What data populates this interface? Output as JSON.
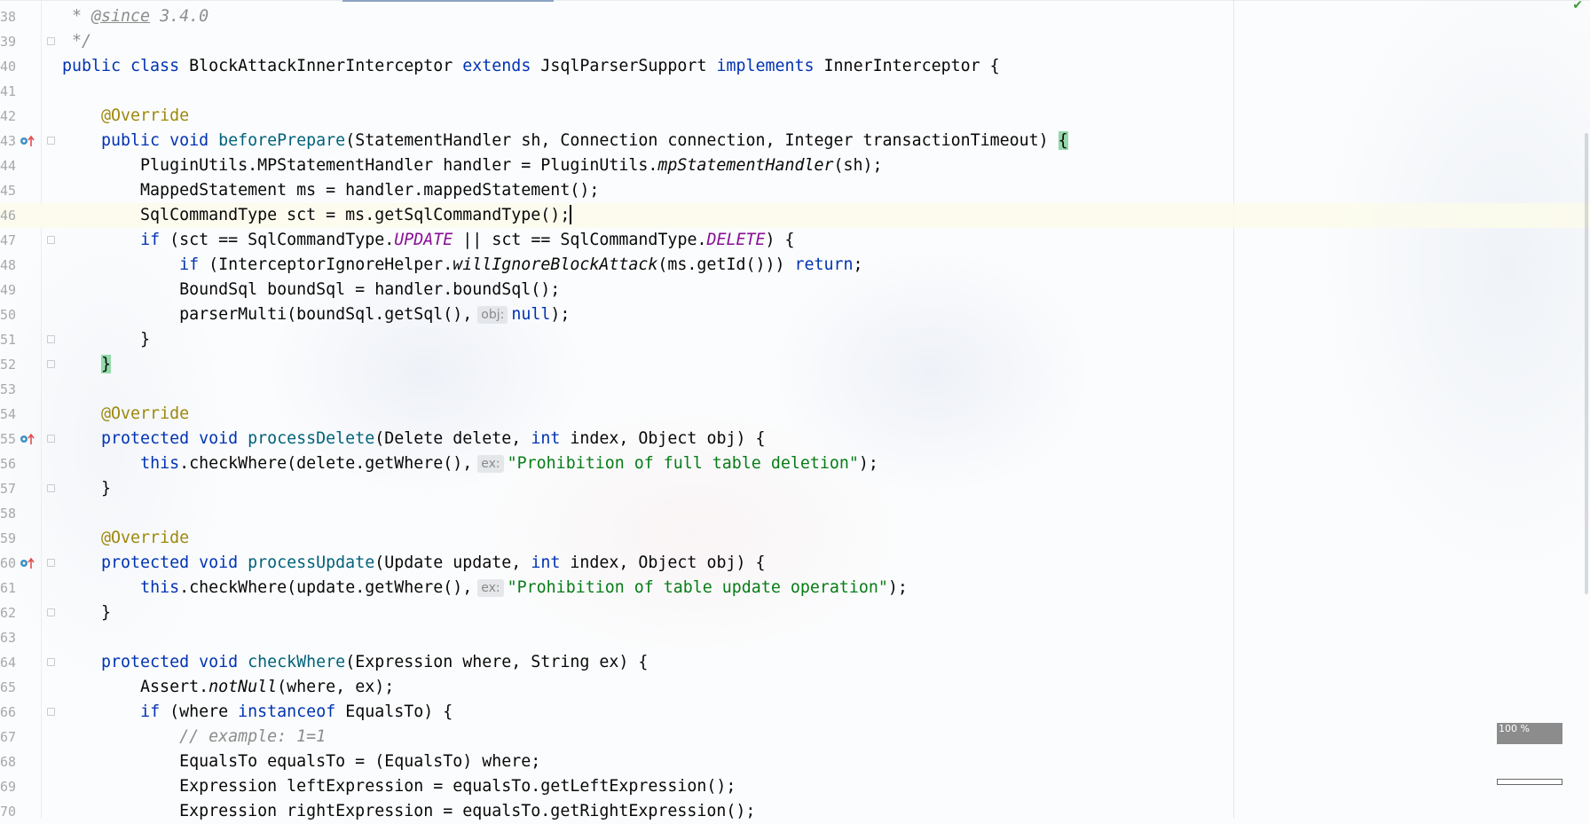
{
  "editor": {
    "first_line": 38,
    "current_line": 46,
    "zoom_label": "100 %",
    "colors": {
      "keyword": "#0033b3",
      "annotation": "#9e880d",
      "method_decl": "#00627a",
      "static_field": "#871094",
      "string": "#067d17",
      "comment": "#8c8c8c",
      "brace_match": "#93d9a9"
    },
    "override_icon_lines": [
      43,
      55,
      60
    ],
    "fold_icon_lines": [
      39,
      43,
      47,
      51,
      52,
      55,
      57,
      60,
      62,
      64,
      66
    ],
    "lines": [
      [
        [
          " * ",
          "c"
        ],
        [
          "@since",
          "ctag"
        ],
        [
          " 3.4.0",
          "c"
        ]
      ],
      [
        [
          " */",
          "c"
        ]
      ],
      [
        [
          "public class ",
          "kw"
        ],
        [
          "BlockAttackInnerInterceptor ",
          ""
        ],
        [
          "extends ",
          "kw"
        ],
        [
          "JsqlParserSupport ",
          ""
        ],
        [
          "implements ",
          "kw"
        ],
        [
          "InnerInterceptor {",
          ""
        ]
      ],
      [],
      [
        [
          "    ",
          ""
        ],
        [
          "@Override",
          "ann"
        ]
      ],
      [
        [
          "    ",
          ""
        ],
        [
          "public void ",
          "kw"
        ],
        [
          "beforePrepare",
          "fn"
        ],
        [
          "(StatementHandler sh, Connection connection, Integer transactionTimeout) ",
          ""
        ],
        [
          "{",
          "br"
        ]
      ],
      [
        [
          "        PluginUtils.MPStatementHandler handler = PluginUtils.",
          ""
        ],
        [
          "mpStatementHandler",
          "it"
        ],
        [
          "(sh);",
          ""
        ]
      ],
      [
        [
          "        MappedStatement ms = handler.mappedStatement();",
          ""
        ]
      ],
      [
        [
          "        SqlCommandType sct = ms.getSqlCommandType();",
          ""
        ],
        [
          "",
          "caret"
        ]
      ],
      [
        [
          "        ",
          ""
        ],
        [
          "if ",
          "kw"
        ],
        [
          "(sct == SqlCommandType.",
          ""
        ],
        [
          "UPDATE",
          "st"
        ],
        [
          " || sct == SqlCommandType.",
          ""
        ],
        [
          "DELETE",
          "st"
        ],
        [
          ") {",
          ""
        ]
      ],
      [
        [
          "            ",
          ""
        ],
        [
          "if ",
          "kw"
        ],
        [
          "(InterceptorIgnoreHelper.",
          ""
        ],
        [
          "willIgnoreBlockAttack",
          "it"
        ],
        [
          "(ms.getId())) ",
          ""
        ],
        [
          "return",
          "kw"
        ],
        [
          ";",
          ""
        ]
      ],
      [
        [
          "            BoundSql boundSql = handler.boundSql();",
          ""
        ]
      ],
      [
        [
          "            parserMulti(boundSql.getSql(),",
          ""
        ],
        [
          "obj:",
          "hint"
        ],
        [
          "null",
          "kw"
        ],
        [
          ");",
          ""
        ]
      ],
      [
        [
          "        }",
          ""
        ]
      ],
      [
        [
          "    ",
          ""
        ],
        [
          "}",
          "br"
        ]
      ],
      [],
      [
        [
          "    ",
          ""
        ],
        [
          "@Override",
          "ann"
        ]
      ],
      [
        [
          "    ",
          ""
        ],
        [
          "protected void ",
          "kw"
        ],
        [
          "processDelete",
          "fn"
        ],
        [
          "(Delete delete, ",
          ""
        ],
        [
          "int ",
          "kw"
        ],
        [
          "index, Object obj) {",
          ""
        ]
      ],
      [
        [
          "        ",
          ""
        ],
        [
          "this",
          "kw"
        ],
        [
          ".checkWhere(delete.getWhere(),",
          ""
        ],
        [
          "ex:",
          "hint"
        ],
        [
          "\"Prohibition of full table deletion\"",
          "str"
        ],
        [
          ");",
          ""
        ]
      ],
      [
        [
          "    }",
          ""
        ]
      ],
      [],
      [
        [
          "    ",
          ""
        ],
        [
          "@Override",
          "ann"
        ]
      ],
      [
        [
          "    ",
          ""
        ],
        [
          "protected void ",
          "kw"
        ],
        [
          "processUpdate",
          "fn"
        ],
        [
          "(Update update, ",
          ""
        ],
        [
          "int ",
          "kw"
        ],
        [
          "index, Object obj) {",
          ""
        ]
      ],
      [
        [
          "        ",
          ""
        ],
        [
          "this",
          "kw"
        ],
        [
          ".checkWhere(update.getWhere(),",
          ""
        ],
        [
          "ex:",
          "hint"
        ],
        [
          "\"Prohibition of table update operation\"",
          "str"
        ],
        [
          ");",
          ""
        ]
      ],
      [
        [
          "    }",
          ""
        ]
      ],
      [],
      [
        [
          "    ",
          ""
        ],
        [
          "protected void ",
          "kw"
        ],
        [
          "checkWhere",
          "fn"
        ],
        [
          "(Expression where, String ex) {",
          ""
        ]
      ],
      [
        [
          "        Assert.",
          ""
        ],
        [
          "notNull",
          "it"
        ],
        [
          "(where, ex);",
          ""
        ]
      ],
      [
        [
          "        ",
          ""
        ],
        [
          "if ",
          "kw"
        ],
        [
          "(where ",
          ""
        ],
        [
          "instanceof ",
          "kw"
        ],
        [
          "EqualsTo) {",
          ""
        ]
      ],
      [
        [
          "            ",
          ""
        ],
        [
          "// example: 1=1",
          "c"
        ]
      ],
      [
        [
          "            EqualsTo equalsTo = (EqualsTo) where;",
          ""
        ]
      ],
      [
        [
          "            Expression leftExpression = equalsTo.getLeftExpression();",
          ""
        ]
      ],
      [
        [
          "            Expression rightExpression = equalsTo.getRightExpression();",
          ""
        ]
      ]
    ]
  }
}
